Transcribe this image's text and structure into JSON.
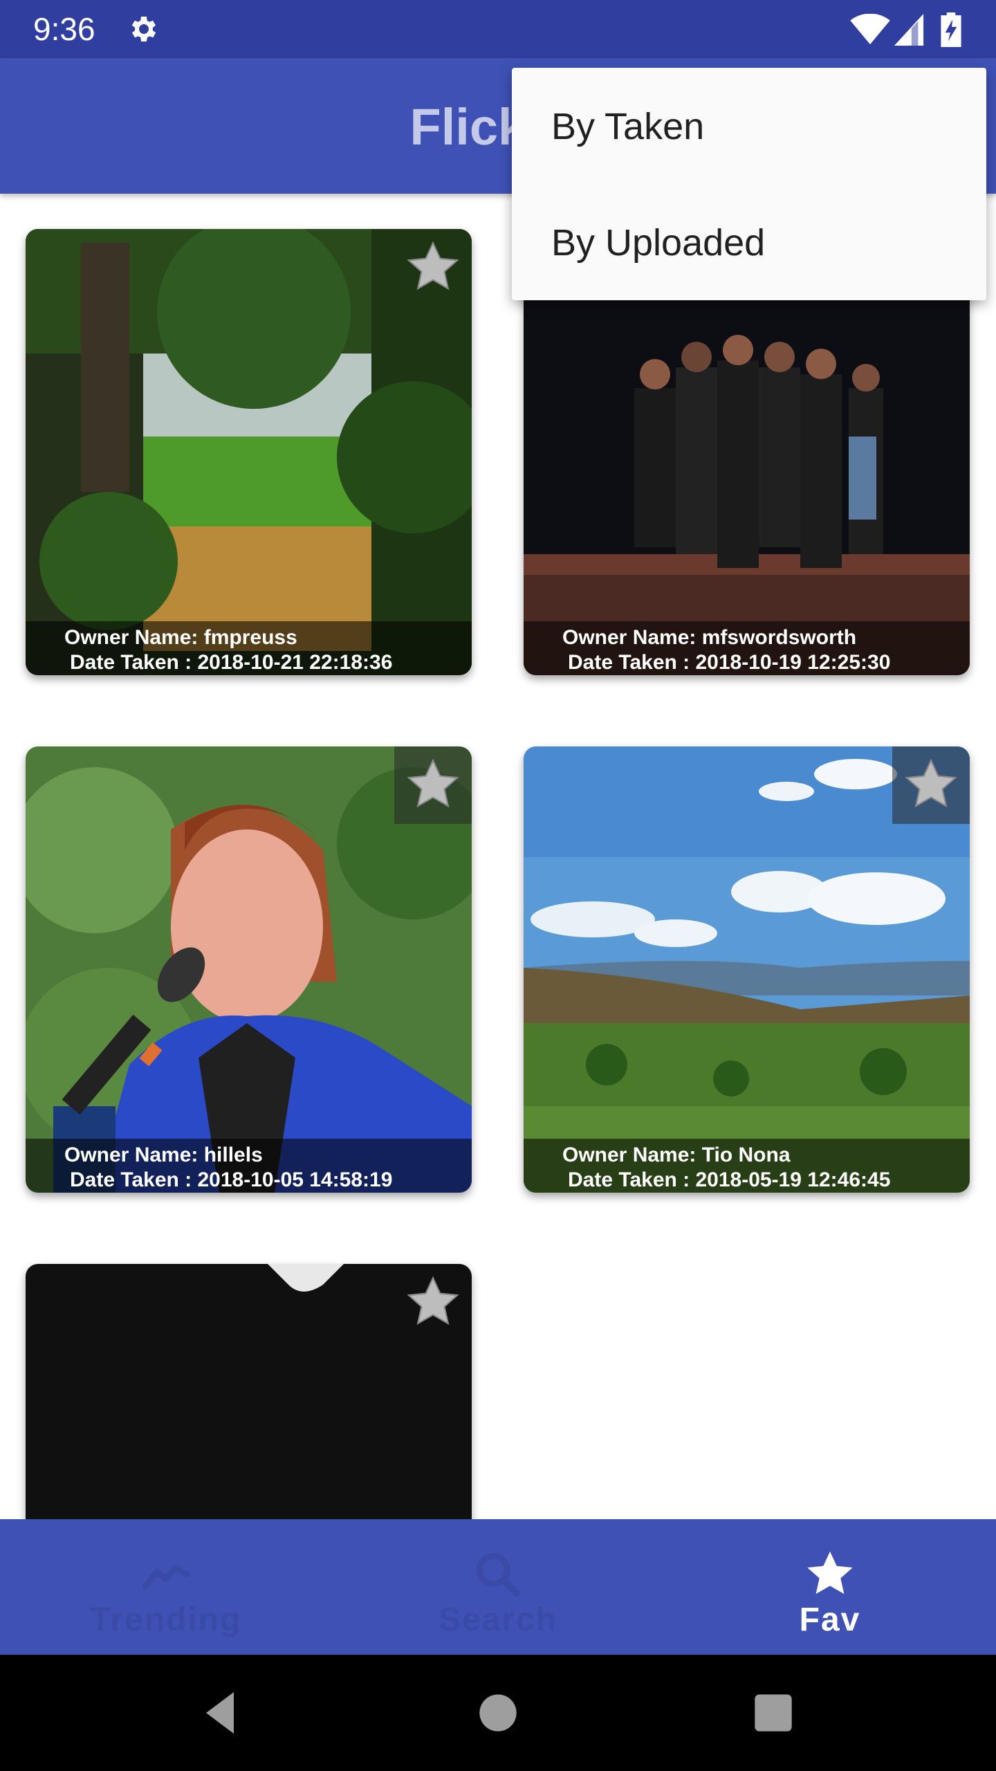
{
  "status_bar": {
    "time": "9:36",
    "icons": [
      "gear-icon",
      "wifi-icon",
      "signal-icon",
      "battery-charging-icon"
    ],
    "background": "#303f9f"
  },
  "app_bar": {
    "title": "FlickrG",
    "background": "#3f51b5",
    "title_color": "#c5cae9"
  },
  "sort_menu": {
    "items": [
      {
        "label": "By Taken"
      },
      {
        "label": "By Uploaded"
      }
    ]
  },
  "photos": [
    {
      "owner": "Owner Name: fmpreuss",
      "date": "Date Taken : 2018-10-21 22:18:36",
      "scene": "forest-field"
    },
    {
      "owner": "Owner Name: mfswordsworth",
      "date": "Date Taken : 2018-10-19 12:25:30",
      "scene": "stage-dancers"
    },
    {
      "owner": "Owner Name: hillels",
      "date": "Date Taken : 2018-10-05 14:58:19",
      "scene": "speaker"
    },
    {
      "owner": "Owner Name: Tio Nona",
      "date": "Date Taken : 2018-05-19 12:46:45",
      "scene": "valley-landscape"
    },
    {
      "owner": "",
      "date": "",
      "scene": "dark-photo"
    }
  ],
  "bottom_nav": {
    "items": [
      {
        "label": "Trending",
        "icon": "trending-icon",
        "active": false
      },
      {
        "label": "Search",
        "icon": "search-icon",
        "active": false
      },
      {
        "label": "Fav",
        "icon": "star-icon",
        "active": true
      }
    ]
  },
  "system_nav": {
    "icons": [
      "back-icon",
      "home-icon",
      "recents-icon"
    ]
  },
  "colors": {
    "primary": "#3f51b5",
    "primary_dark": "#303f9f",
    "inactive_nav": "#3a4aa6"
  }
}
